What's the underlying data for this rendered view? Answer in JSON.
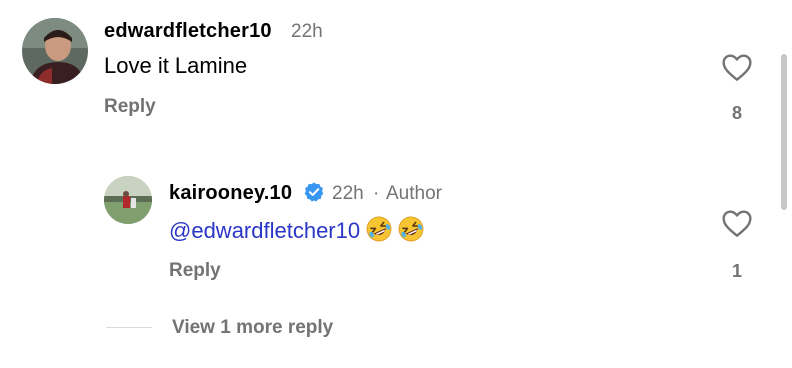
{
  "comment": {
    "username": "edwardfletcher10",
    "time": "22h",
    "text": "Love it Lamine",
    "reply_label": "Reply",
    "likes": "8"
  },
  "reply": {
    "username": "kairooney.10",
    "time": "22h",
    "separator": "·",
    "role": "Author",
    "mention": "@edwardfletcher10",
    "emojis": [
      "rolling-on-floor-laughing",
      "rolling-on-floor-laughing"
    ],
    "reply_label": "Reply",
    "likes": "1"
  },
  "view_more": "View 1 more reply",
  "colors": {
    "mention": "#2a36c7",
    "verified": "#3897f0",
    "muted": "#737373"
  }
}
